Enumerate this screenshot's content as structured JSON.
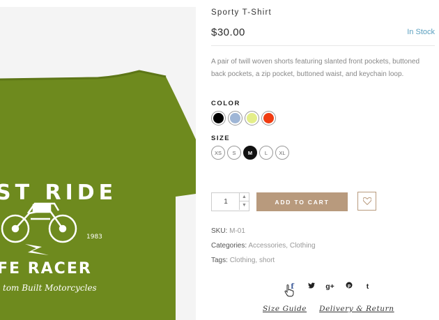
{
  "product": {
    "title": "Sporty T-Shirt",
    "price": "$30.00",
    "stock": "In Stock",
    "description": "A pair of twill woven shorts featuring slanted front pockets, buttoned back pockets, a zip pocket, buttoned waist, and keychain loop.",
    "image": {
      "shirt_color": "#6e8a1e",
      "print_line1": "ST RIDE",
      "print_line2": "FE RACER",
      "print_line3": "tom Built Motorcycles",
      "print_year": "1983"
    }
  },
  "options": {
    "color_label": "COLOR",
    "colors": [
      "#000000",
      "#9fb6d6",
      "#e4ee8a",
      "#f03c12"
    ],
    "size_label": "SIZE",
    "sizes": [
      "XS",
      "S",
      "M",
      "L",
      "XL"
    ],
    "selected_size": "M"
  },
  "cart": {
    "quantity": "1",
    "qty_up": "^",
    "qty_down": "v",
    "add_label": "ADD TO CART",
    "accent": "#b89a7d"
  },
  "meta": {
    "sku_label": "SKU:",
    "sku": "M-01",
    "categories_label": "Categories:",
    "category1": "Accessories",
    "category2": "Clothing",
    "tags_label": "Tags:",
    "tag1": "Clothing",
    "tag2": "short"
  },
  "social": {
    "facebook": "f",
    "twitter": "🐦",
    "google_plus": "g+",
    "pinterest": "P",
    "tumblr": "t"
  },
  "links": {
    "size_guide": "Size Guide",
    "delivery": "Delivery & Return"
  }
}
